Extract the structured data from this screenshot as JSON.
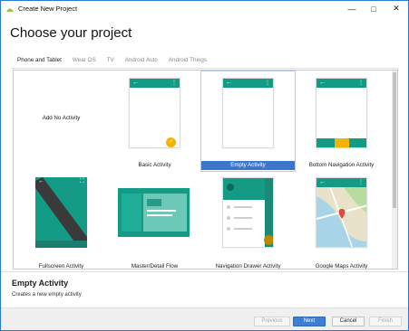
{
  "window": {
    "title": "Create New Project",
    "minimize": "—",
    "maximize": "□",
    "close": "✕"
  },
  "heading": "Choose your project",
  "tabs": [
    "Phone and Tablet",
    "Wear OS",
    "TV",
    "Android Auto",
    "Android Things"
  ],
  "active_tab": "Phone and Tablet",
  "templates": [
    {
      "label": "Add No Activity"
    },
    {
      "label": "Basic Activity"
    },
    {
      "label": "Empty Activity",
      "selected": true
    },
    {
      "label": "Bottom Navigation Activity"
    },
    {
      "label": "Fullscreen Activity"
    },
    {
      "label": "Master/Detail Flow"
    },
    {
      "label": "Navigation Drawer Activity"
    },
    {
      "label": "Google Maps Activity"
    }
  ],
  "glyphs": {
    "back": "←",
    "more": "⋮",
    "fab": "✓",
    "fullscreen": "⛶"
  },
  "detail": {
    "title": "Empty Activity",
    "description": "Creates a new empty activity"
  },
  "buttons": {
    "previous": "Previous",
    "next": "Next",
    "cancel": "Cancel",
    "finish": "Finish"
  },
  "colors": {
    "accent": "#139b86",
    "selection": "#3c75cc",
    "fab": "#f2b400"
  }
}
